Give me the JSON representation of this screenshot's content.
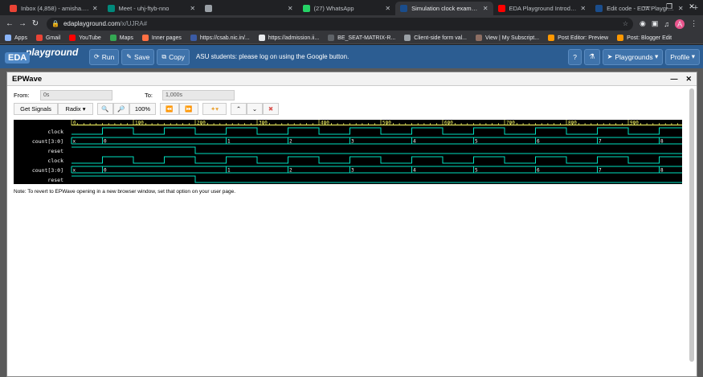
{
  "browser": {
    "tabs": [
      {
        "title": "Inbox (4,858) - amisha.singh",
        "color": "#ea4335",
        "active": false
      },
      {
        "title": "Meet - uhj-ftyb-nno",
        "color": "#00897b",
        "active": false
      },
      {
        "title": "",
        "color": "#9aa0a6",
        "active": false
      },
      {
        "title": "(27) WhatsApp",
        "color": "#25d366",
        "active": false
      },
      {
        "title": "Simulation clock example(1)",
        "color": "#1a4d8c",
        "active": true
      },
      {
        "title": "EDA Playground Introduction",
        "color": "#ff0000",
        "active": false
      },
      {
        "title": "Edit code - EDA Playground",
        "color": "#1a4d8c",
        "active": false
      }
    ],
    "url_host": "edaplayground.com",
    "url_path": "/x/UJRA#",
    "avatar_letter": "A",
    "bookmarks": [
      {
        "label": "Apps",
        "color": "#8ab4f8"
      },
      {
        "label": "Gmail",
        "color": "#ea4335"
      },
      {
        "label": "YouTube",
        "color": "#ff0000"
      },
      {
        "label": "Maps",
        "color": "#34a853"
      },
      {
        "label": "Inner pages",
        "color": "#ff7043"
      },
      {
        "label": "https://csab.nic.in/...",
        "color": "#3b5ba5"
      },
      {
        "label": "https://admission.ii...",
        "color": "#e8eaed"
      },
      {
        "label": "BE_SEAT-MATRIX-R...",
        "color": "#5f6368"
      },
      {
        "label": "Client-side form val...",
        "color": "#9aa0a6"
      },
      {
        "label": "View | My Subscript...",
        "color": "#8d6e63"
      },
      {
        "label": "Post Editor: Preview",
        "color": "#ff9800"
      },
      {
        "label": "Post: Blogger Edit",
        "color": "#ff9800"
      }
    ]
  },
  "eda": {
    "logo_eda": "EDA",
    "logo_playground": "playground",
    "run_label": "Run",
    "save_label": "Save",
    "copy_label": "Copy",
    "message": "ASU students: please log on using the Google button.",
    "playgrounds_label": "Playgrounds",
    "profile_label": "Profile"
  },
  "epwave": {
    "title": "EPWave",
    "from_label": "From:",
    "from_value": "0s",
    "to_label": "To:",
    "to_value": "1,000s",
    "get_signals": "Get Signals",
    "radix": "Radix",
    "zoom": "100%",
    "note": "Note: To revert to EPWave opening in a new browser window, set that option on your user page.",
    "ticks": [
      "0",
      "100",
      "200",
      "300",
      "400",
      "500",
      "600",
      "700",
      "800",
      "900"
    ],
    "signals": [
      "clock",
      "count[3:0]",
      "reset",
      "clock",
      "count[3:0]",
      "reset"
    ],
    "count_values": [
      "x",
      "0",
      "1",
      "2",
      "3",
      "4",
      "5",
      "6",
      "7",
      "8"
    ],
    "clock_period": 100,
    "count_changes": [
      0,
      50,
      250,
      350,
      450,
      550,
      650,
      750,
      850,
      950
    ],
    "reset_high_until": 200
  }
}
